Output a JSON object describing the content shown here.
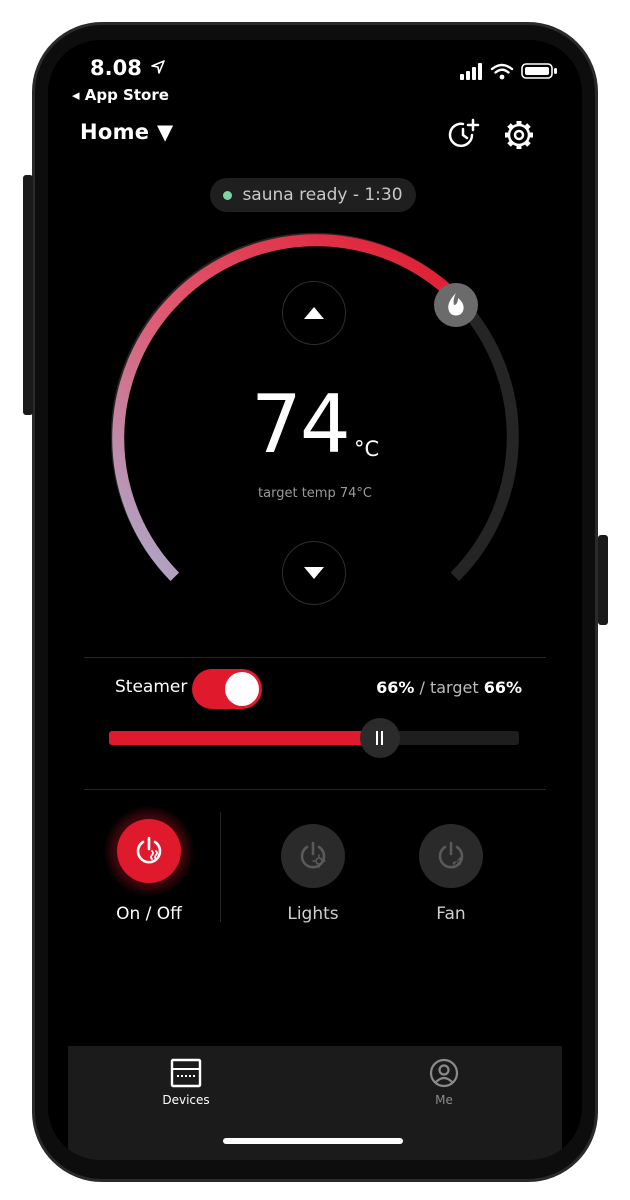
{
  "status_bar": {
    "time": "8.08",
    "back_label": "◂ App Store"
  },
  "header": {
    "title": "Home ▼"
  },
  "status_pill": {
    "text": "sauna ready - 1:30",
    "dot_color": "#7fd3a0"
  },
  "dial": {
    "temperature": "74",
    "unit": "°C",
    "target_text": "target temp 74°C",
    "accent": "#e0192c",
    "gradient_start": "#a8b0d2"
  },
  "steamer": {
    "label": "Steamer",
    "enabled": true,
    "current": "66%",
    "separator": " / target ",
    "target": "66%",
    "level_percent": 66
  },
  "controls": [
    {
      "label": "On / Off",
      "icon": "power-heat-icon",
      "active": true
    },
    {
      "label": "Lights",
      "icon": "power-light-icon",
      "active": false
    },
    {
      "label": "Fan",
      "icon": "power-fan-icon",
      "active": false
    }
  ],
  "tabs": [
    {
      "label": "Devices",
      "icon": "devices-icon",
      "active": true
    },
    {
      "label": "Me",
      "icon": "profile-icon",
      "active": false
    }
  ]
}
